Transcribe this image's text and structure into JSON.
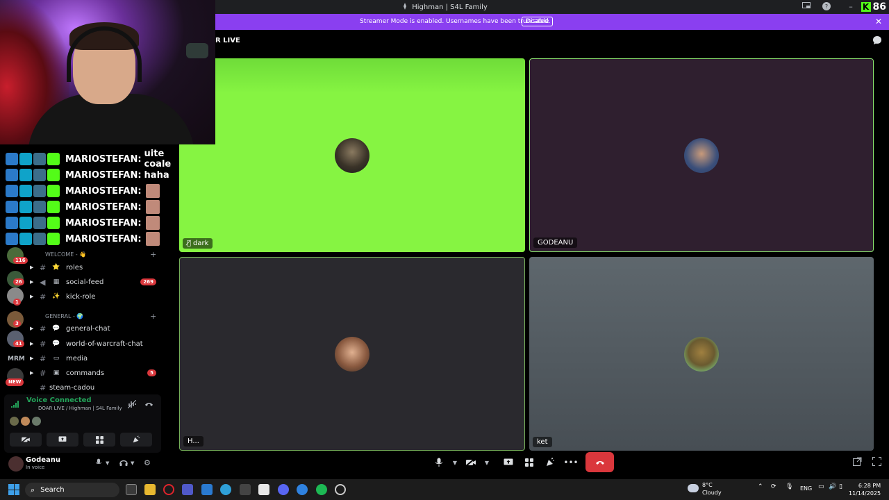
{
  "window": {
    "title": "Highman | S4L Family",
    "kick_count": "86"
  },
  "banner": {
    "text": "Streamer Mode is enabled. Usernames have been truncated.",
    "disable_label": "Disable"
  },
  "voice": {
    "channel_name_partial": "R LIVE",
    "tiles": [
      {
        "name": "dark",
        "bg": "#86f442"
      },
      {
        "name": "GODEANU",
        "bg": "#2f1f2f"
      },
      {
        "name": "H...",
        "bg": "#2a292e"
      },
      {
        "name": "ket",
        "bg": "#545c62"
      }
    ]
  },
  "chat_overlay": [
    {
      "user": "MARIOSTEFAN:",
      "message": "uite coale"
    },
    {
      "user": "MARIOSTEFAN:",
      "message": "haha"
    },
    {
      "user": "MARIOSTEFAN:",
      "message": ""
    },
    {
      "user": "MARIOSTEFAN:",
      "message": ""
    },
    {
      "user": "MARIOSTEFAN:",
      "message": ""
    },
    {
      "user": "MARIOSTEFAN:",
      "message": ""
    }
  ],
  "servers": {
    "badges": [
      "116",
      "26",
      "1",
      "3",
      "41"
    ],
    "text_server": "MRM",
    "new_label": "NEW"
  },
  "channels": {
    "welcome_category": "WELCOME - 👋",
    "general_category": "GENERAL - 🌍",
    "items": [
      {
        "label": "roles",
        "emoji": "⭐",
        "count": ""
      },
      {
        "label": "social-feed",
        "emoji": "▦",
        "count": "269"
      },
      {
        "label": "kick-role",
        "emoji": "✨",
        "count": ""
      },
      {
        "label": "general-chat",
        "emoji": "💬",
        "count": ""
      },
      {
        "label": "world-of-warcraft-chat",
        "emoji": "💬",
        "count": ""
      },
      {
        "label": "media",
        "emoji": "▭",
        "count": ""
      },
      {
        "label": "commands",
        "emoji": "▣",
        "count": "5"
      },
      {
        "label": "steam-cadou",
        "emoji": "",
        "count": ""
      }
    ]
  },
  "voice_panel": {
    "status": "Voice Connected",
    "location": "DOAR LIVE / Highman | S4L Family"
  },
  "user": {
    "name": "Godeanu",
    "status": "In voice"
  },
  "taskbar": {
    "search_label": "Search",
    "temperature": "8°C",
    "weather": "Cloudy",
    "language": "ENG",
    "time": "6:28 PM",
    "date": "11/14/2025"
  },
  "colors": {
    "banner": "#8a3ff0",
    "hangup": "#da373c",
    "voice_connected": "#23a55a",
    "speaking_border": "#8ae56e"
  }
}
